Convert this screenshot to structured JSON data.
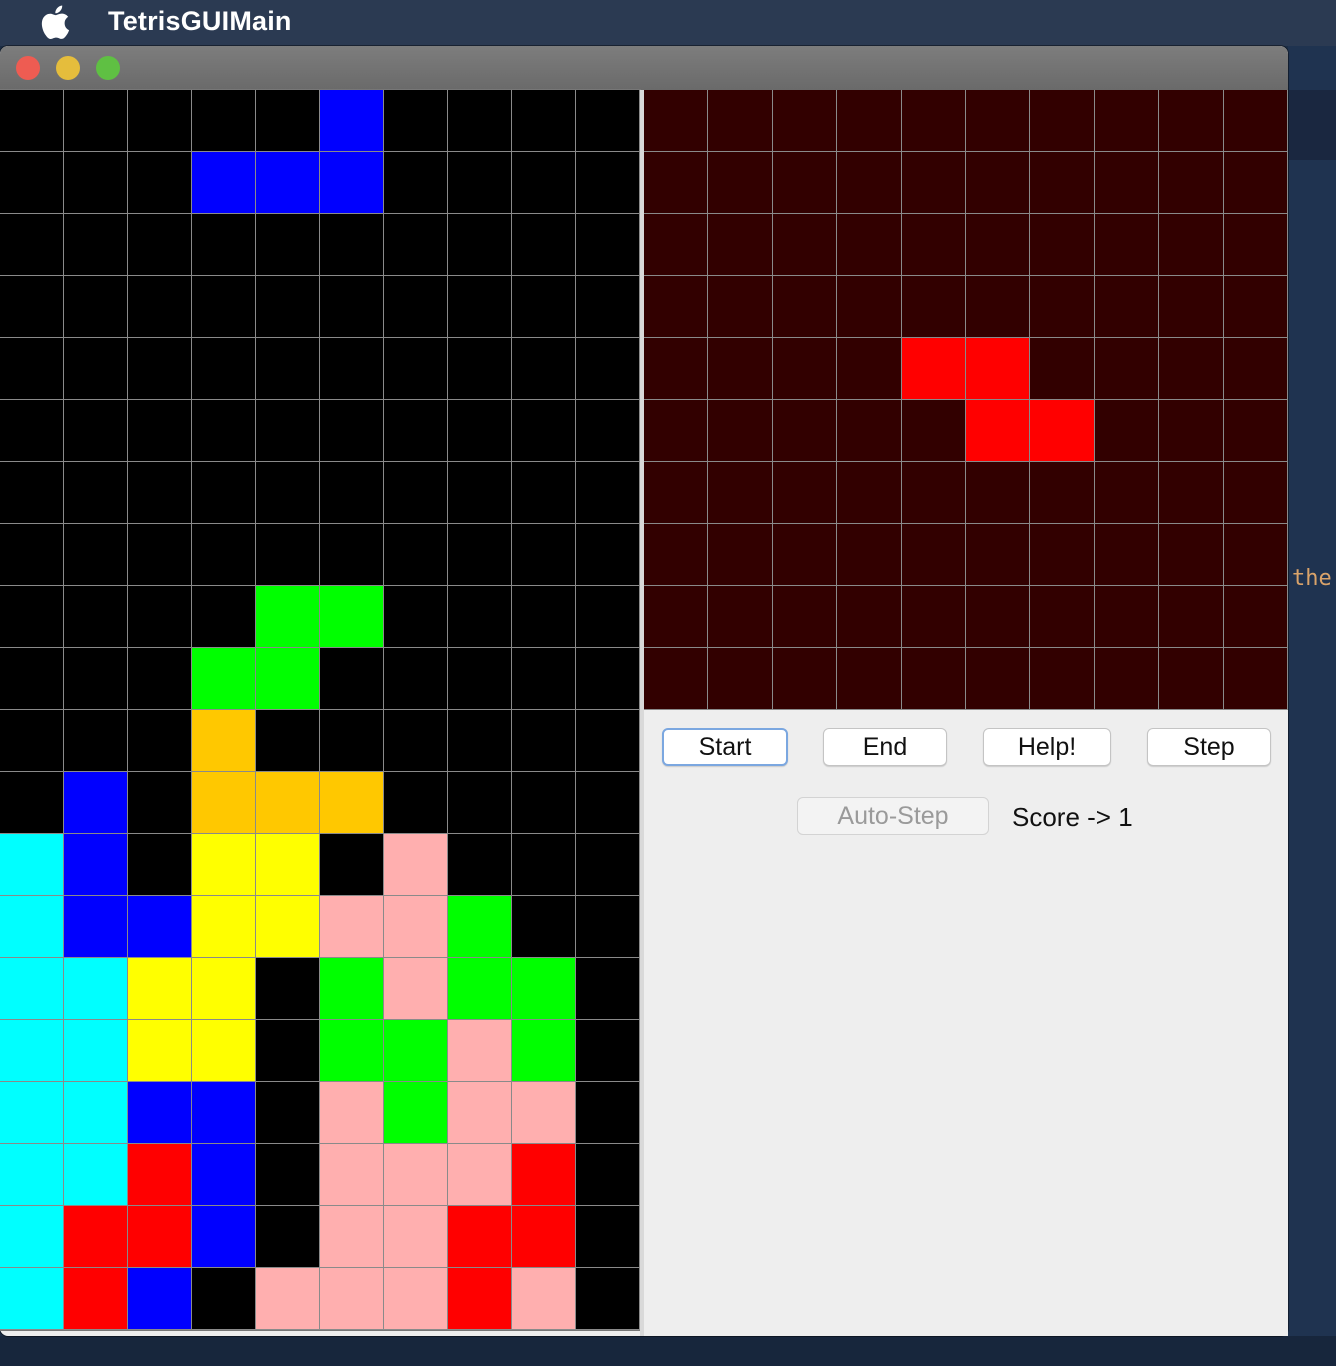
{
  "menubar": {
    "app_name": "TetrisGUIMain"
  },
  "background": {
    "code_snippet": "the"
  },
  "colors": {
    "empty": "#000000",
    "preview_empty": "#320000",
    "B": "#0000ff",
    "G": "#00ff00",
    "O": "#ffc800",
    "C": "#00ffff",
    "Y": "#ffff00",
    "P": "#ffafaf",
    "R": "#ff0000"
  },
  "board": {
    "rows": [
      ".....B....",
      "...BBB....",
      "..........",
      "..........",
      "..........",
      "..........",
      "..........",
      "..........",
      "....GG....",
      "...GG.....",
      "...O......",
      ".B.OOO....",
      "CB.YY.P...",
      "CBBYYPPG..",
      "CCYY.GPGG.",
      "CCYY.GGPG.",
      "CCBB.PGPP.",
      "CCRB.PPPR.",
      "CRRB.PPRR.",
      "CRB.PPPRP."
    ]
  },
  "preview": {
    "rows": [
      "..........",
      "..........",
      "..........",
      "..........",
      "....RR....",
      ".....RR...",
      "..........",
      "..........",
      "..........",
      ".........."
    ]
  },
  "controls": {
    "start_label": "Start",
    "end_label": "End",
    "help_label": "Help!",
    "step_label": "Step",
    "autostep_label": "Auto-Step",
    "score_text": "Score -> 1"
  }
}
